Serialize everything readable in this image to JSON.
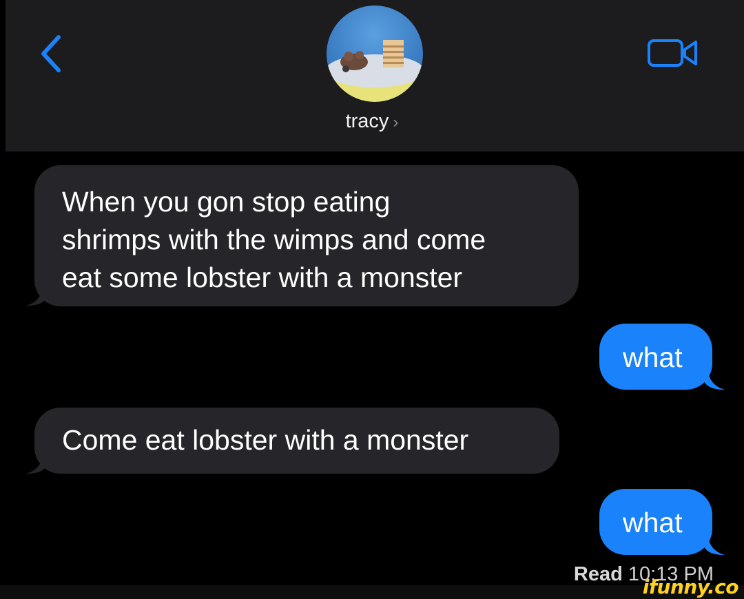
{
  "header": {
    "contact_name": "tracy",
    "chevron": "›",
    "back_icon": "chevron-left-icon",
    "video_icon": "video-camera-icon",
    "avatar": "contact-avatar"
  },
  "colors": {
    "accent": "#1a82fb",
    "incoming_bubble": "#26262a",
    "header_bg": "#1c1c1e",
    "background": "#000000"
  },
  "messages": [
    {
      "direction": "incoming",
      "text": "When you gon stop eating\nshrimps with the wimps and come\neat some lobster with a monster"
    },
    {
      "direction": "outgoing",
      "text": "what"
    },
    {
      "direction": "incoming",
      "text": "Come eat lobster with a monster"
    },
    {
      "direction": "outgoing",
      "text": "what"
    }
  ],
  "status": {
    "read_label": "Read",
    "read_time": "10:13 PM"
  },
  "watermark": "ifunny.co"
}
